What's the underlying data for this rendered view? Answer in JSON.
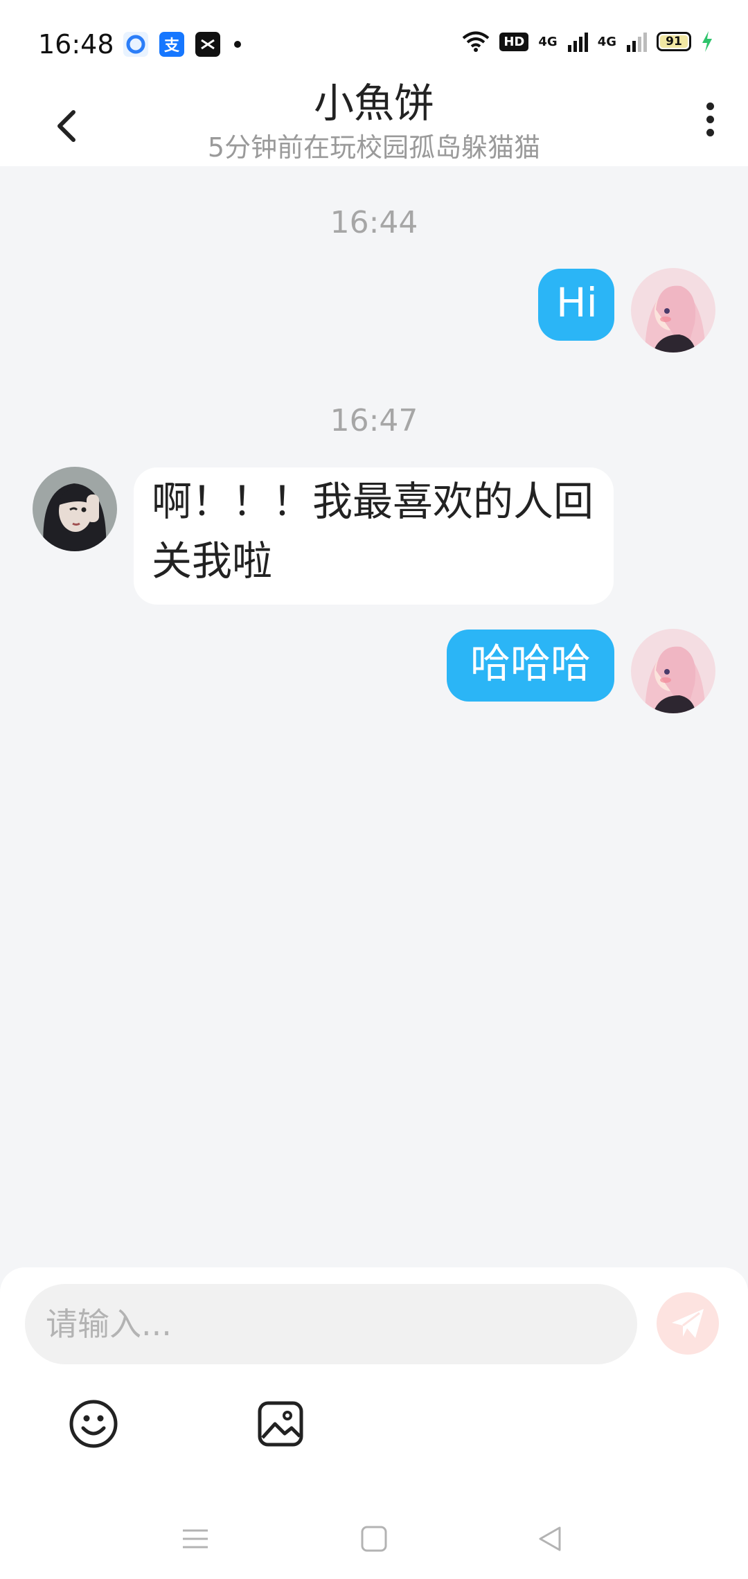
{
  "status_bar": {
    "time": "16:48",
    "signal_1_label": "4G",
    "signal_2_label": "4G",
    "hd_label": "HD",
    "battery": "91",
    "app_icons": [
      "browser-icon",
      "alipay-icon",
      "capcut-icon"
    ]
  },
  "header": {
    "title": "小魚饼",
    "subtitle": "5分钟前在玩校园孤岛躲猫猫"
  },
  "messages": [
    {
      "timestamp": "16:44"
    },
    {
      "direction": "out",
      "text": "Hi"
    },
    {
      "timestamp": "16:47"
    },
    {
      "direction": "in",
      "text": "啊！！！我最喜欢的人回关我啦"
    },
    {
      "direction": "out",
      "text": "哈哈哈"
    }
  ],
  "input": {
    "placeholder": "请输入..."
  },
  "icons": {
    "back": "back-arrow-icon",
    "more": "more-vertical-icon",
    "send": "paper-plane-icon",
    "emoji": "emoji-icon",
    "image": "image-icon"
  },
  "colors": {
    "accent": "#2bb5f6",
    "background": "#f4f5f7",
    "send_button": "#fde3e0"
  }
}
